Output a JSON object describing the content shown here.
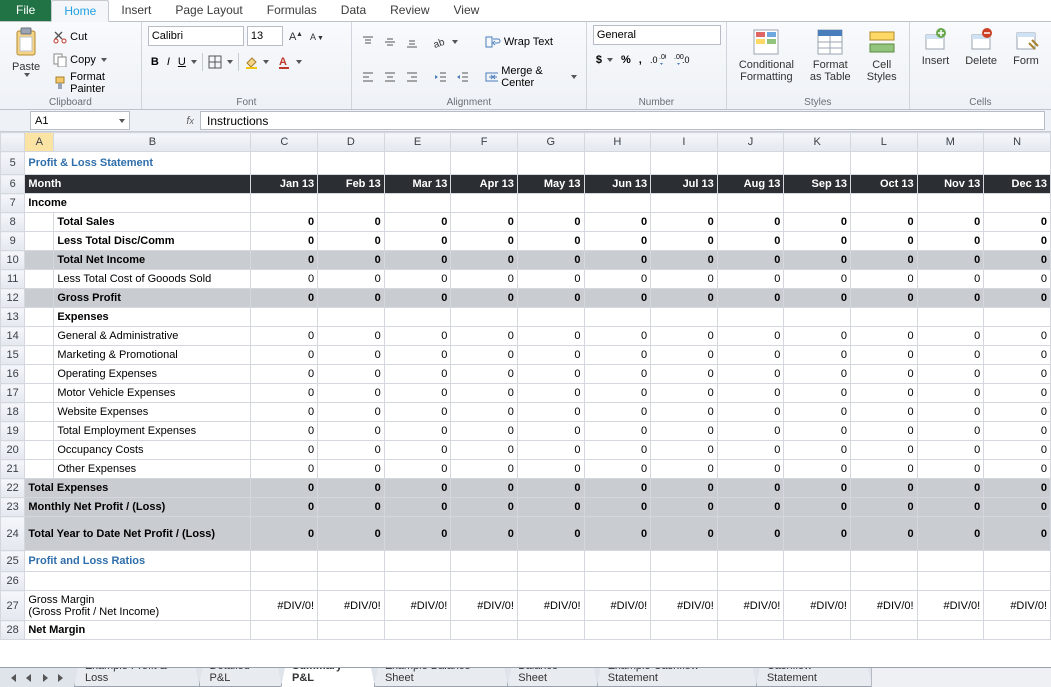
{
  "ribbon": {
    "file": "File",
    "tabs": [
      "Home",
      "Insert",
      "Page Layout",
      "Formulas",
      "Data",
      "Review",
      "View"
    ],
    "active_tab": 0,
    "clipboard": {
      "label": "Clipboard",
      "paste": "Paste",
      "cut": "Cut",
      "copy": "Copy",
      "format_painter": "Format Painter"
    },
    "font": {
      "label": "Font",
      "name": "Calibri",
      "size": "13"
    },
    "alignment": {
      "label": "Alignment",
      "wrap": "Wrap Text",
      "merge": "Merge & Center"
    },
    "number": {
      "label": "Number",
      "format": "General"
    },
    "styles": {
      "label": "Styles",
      "cond": "Conditional\nFormatting",
      "table": "Format\nas Table",
      "cell": "Cell\nStyles"
    },
    "cells": {
      "label": "Cells",
      "insert": "Insert",
      "delete": "Delete",
      "format": "Form"
    }
  },
  "namebox": "A1",
  "formula": "Instructions",
  "columns": [
    "A",
    "B",
    "C",
    "D",
    "E",
    "F",
    "G",
    "H",
    "I",
    "J",
    "K",
    "L",
    "M",
    "N"
  ],
  "rows": {
    "title": "Profit & Loss Statement",
    "month_label": "Month",
    "months": [
      "Jan 13",
      "Feb 13",
      "Mar 13",
      "Apr 13",
      "May 13",
      "Jun 13",
      "Jul 13",
      "Aug 13",
      "Sep 13",
      "Oct 13",
      "Nov 13",
      "Dec 13"
    ],
    "income": "Income",
    "r8": "Total Sales",
    "r9": "Less Total Disc/Comm",
    "r10": "Total Net Income",
    "r11": "Less Total Cost of Gooods Sold",
    "r12": "Gross Profit",
    "r13": "Expenses",
    "r14": "General & Administrative",
    "r15": "Marketing & Promotional",
    "r16": "Operating Expenses",
    "r17": "Motor Vehicle Expenses",
    "r18": "Website Expenses",
    "r19": "Total Employment Expenses",
    "r20": "Occupancy Costs",
    "r21": "Other Expenses",
    "r22": "Total Expenses",
    "r23": "Monthly Net Profit / (Loss)",
    "r24": "Total Year to Date Net Profit / (Loss)",
    "ratios": "Profit and Loss Ratios",
    "r27a": "Gross Margin",
    "r27b": "(Gross Profit / Net Income)",
    "r28": "Net Margin",
    "zero": "0",
    "div0": "#DIV/0!"
  },
  "sheets": {
    "tabs": [
      "Example Profit & Loss",
      "Detailed P&L",
      "Summary P&L",
      "Example Balance Sheet",
      "Balance Sheet",
      "Example Cashflow Statement",
      "Cashflow Statement"
    ],
    "active": 2
  }
}
